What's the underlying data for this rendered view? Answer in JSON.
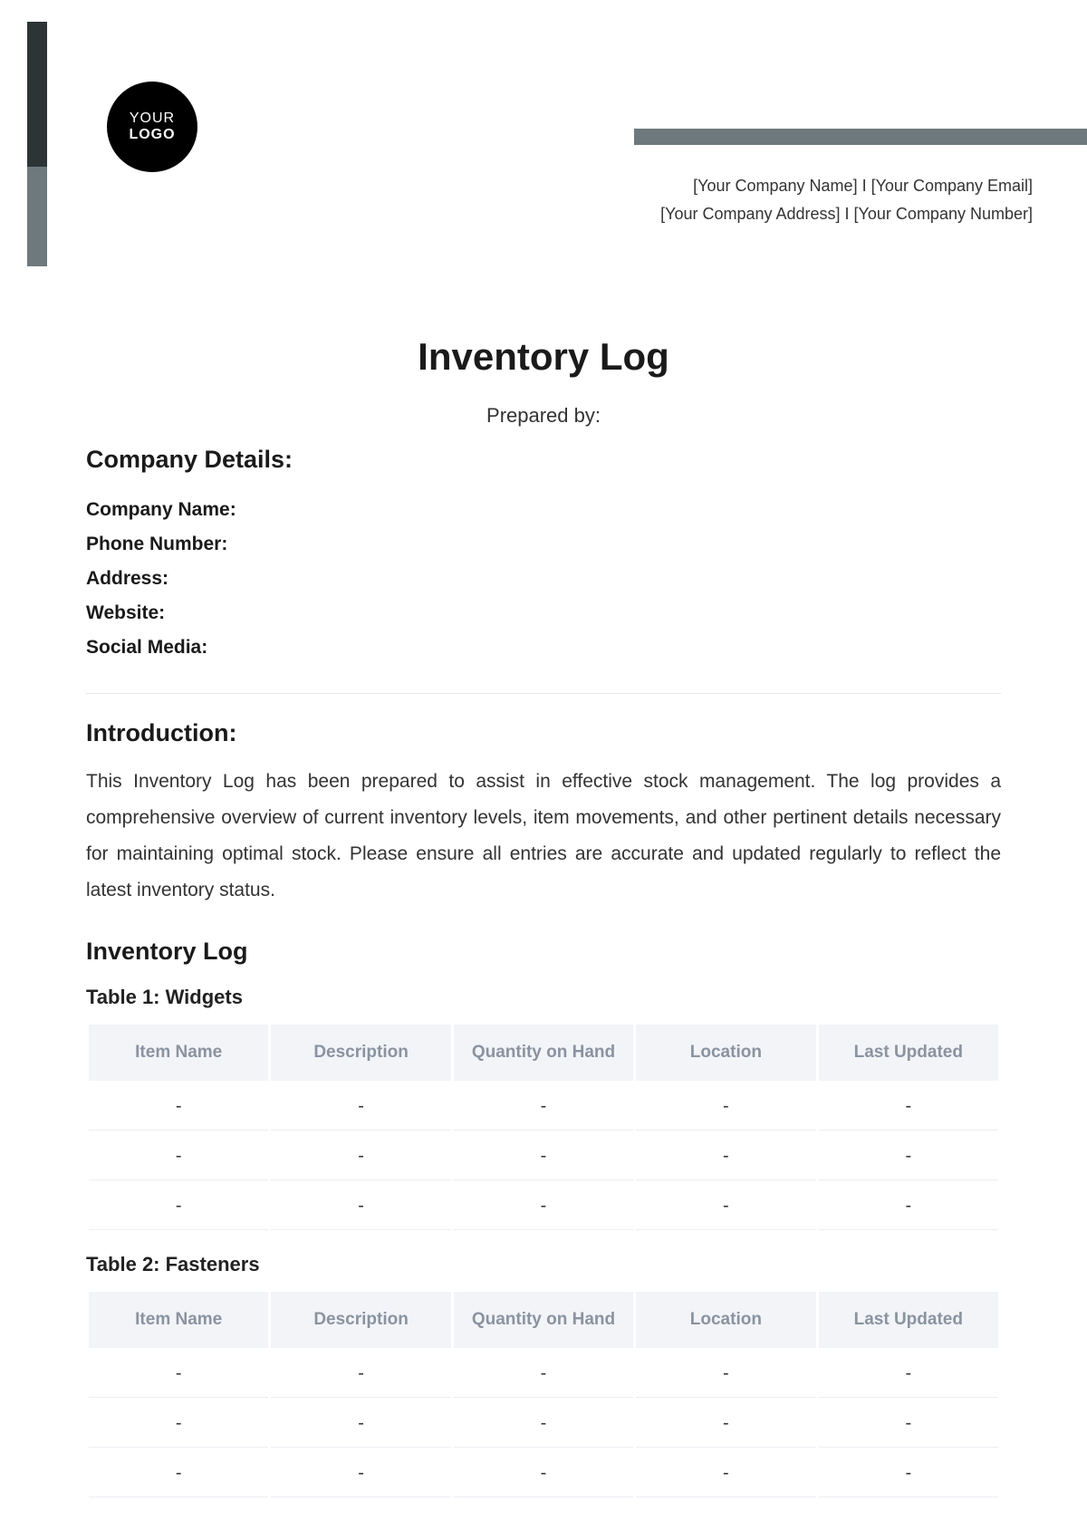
{
  "logo": {
    "line1": "YOUR",
    "line2": "LOGO"
  },
  "header": {
    "line1": "[Your Company Name] I [Your Company Email]",
    "line2": "[Your Company Address] I [Your Company Number]"
  },
  "title": "Inventory Log",
  "prepared_by_label": "Prepared by:",
  "company_details": {
    "heading": "Company Details:",
    "fields": {
      "name": "Company Name:",
      "phone": "Phone Number:",
      "address": "Address:",
      "website": "Website:",
      "social": "Social Media:"
    }
  },
  "introduction": {
    "heading": "Introduction:",
    "text": "This Inventory Log has been prepared to assist in effective stock management. The log provides a comprehensive overview of current inventory levels, item movements, and other pertinent details necessary for maintaining optimal stock. Please ensure all entries are accurate and updated regularly to reflect the latest inventory status."
  },
  "inventory_heading": "Inventory Log",
  "columns": [
    "Item Name",
    "Description",
    "Quantity on Hand",
    "Location",
    "Last Updated"
  ],
  "tables": [
    {
      "title": "Table 1: Widgets",
      "rows": [
        [
          "-",
          "-",
          "-",
          "-",
          "-"
        ],
        [
          "-",
          "-",
          "-",
          "-",
          "-"
        ],
        [
          "-",
          "-",
          "-",
          "-",
          "-"
        ]
      ]
    },
    {
      "title": "Table 2: Fasteners",
      "rows": [
        [
          "-",
          "-",
          "-",
          "-",
          "-"
        ],
        [
          "-",
          "-",
          "-",
          "-",
          "-"
        ],
        [
          "-",
          "-",
          "-",
          "-",
          "-"
        ]
      ]
    }
  ]
}
